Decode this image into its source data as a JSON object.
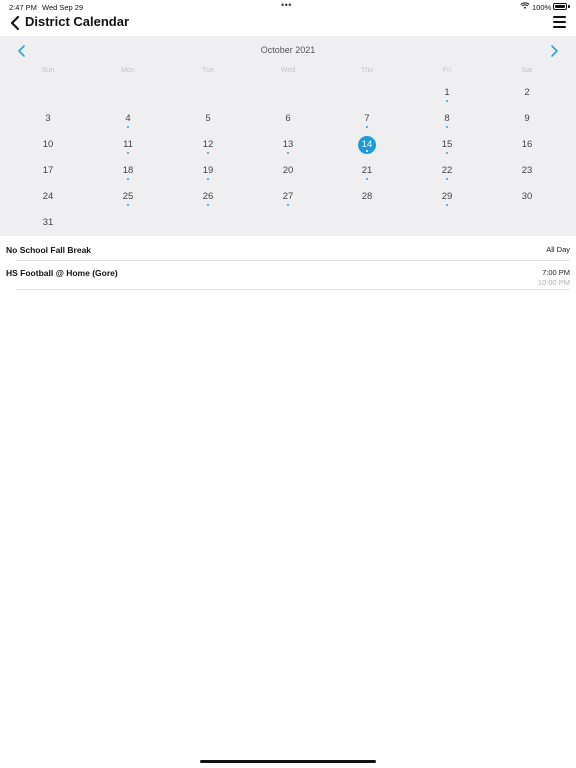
{
  "status_bar": {
    "time": "2:47 PM",
    "date": "Wed Sep 29",
    "dots": "•••",
    "battery_pct": "100%"
  },
  "nav": {
    "title": "District Calendar",
    "back_icon": "chevron-left-icon",
    "menu_icon": "hamburger-menu-icon"
  },
  "calendar": {
    "month": "October 2021",
    "weekdays": [
      "Sun",
      "Mon",
      "Tue",
      "Wed",
      "Thu",
      "Fri",
      "Sat"
    ],
    "weeks": [
      [
        "",
        "",
        "",
        "",
        "",
        "1",
        "2"
      ],
      [
        "3",
        "4",
        "5",
        "6",
        "7",
        "8",
        "9"
      ],
      [
        "10",
        "11",
        "12",
        "13",
        "14",
        "15",
        "16"
      ],
      [
        "17",
        "18",
        "19",
        "20",
        "21",
        "22",
        "23"
      ],
      [
        "24",
        "25",
        "26",
        "27",
        "28",
        "29",
        "30"
      ],
      [
        "31",
        "",
        "",
        "",
        "",
        "",
        ""
      ]
    ],
    "selected_day": "14",
    "event_days": [
      "1",
      "4",
      "7",
      "8",
      "11",
      "12",
      "13",
      "14",
      "15",
      "18",
      "19",
      "21",
      "22",
      "25",
      "26",
      "27",
      "29"
    ],
    "accent_color": "#1c9cd8"
  },
  "events": [
    {
      "name": "No School Fall Break",
      "time": "All Day",
      "end": ""
    },
    {
      "name": "HS Football @ Home (Gore)",
      "time": "7:00 PM",
      "end": "10:00 PM"
    }
  ]
}
